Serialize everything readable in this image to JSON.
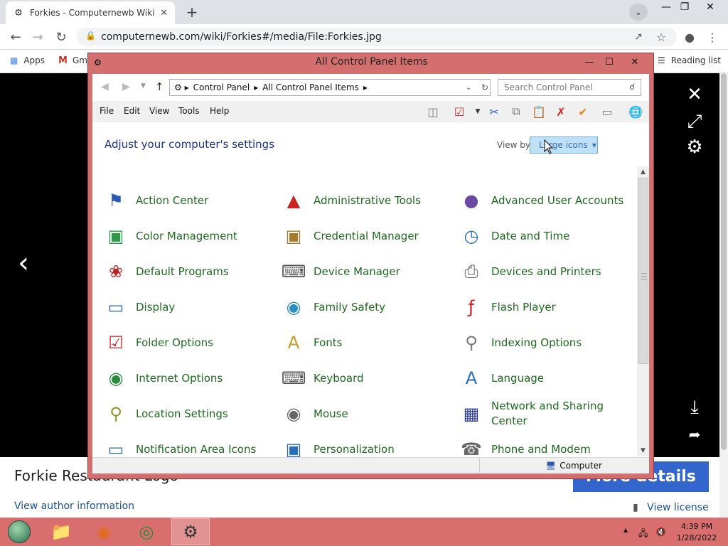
{
  "browser": {
    "tab_title": "Forkies - Computernewb Wiki",
    "url": "computernewb.com/wiki/Forkies#/media/File:Forkies.jpg",
    "bookmarks": [
      "Apps",
      "Gm"
    ],
    "reading_list": "Reading list"
  },
  "viewer": {
    "file_title": "Forkie Restaurant Logo",
    "more_details": "More details",
    "author_link": "View author information",
    "license_link": "View license"
  },
  "control_panel": {
    "title": "All Control Panel Items",
    "breadcrumb": [
      "Control Panel",
      "All Control Panel Items"
    ],
    "search_placeholder": "Search Control Panel",
    "menu": [
      "File",
      "Edit",
      "View",
      "Tools",
      "Help"
    ],
    "heading": "Adjust your computer's settings",
    "view_by_label": "View by:",
    "view_by_value": "Large icons",
    "status_text": "Computer",
    "items": [
      {
        "label": "Action Center",
        "icon": "flag-icon"
      },
      {
        "label": "Administrative Tools",
        "icon": "admin-tools-icon"
      },
      {
        "label": "Advanced User Accounts",
        "icon": "users-icon"
      },
      {
        "label": "Color Management",
        "icon": "color-management-icon"
      },
      {
        "label": "Credential Manager",
        "icon": "credential-icon"
      },
      {
        "label": "Date and Time",
        "icon": "calendar-clock-icon"
      },
      {
        "label": "Default Programs",
        "icon": "default-programs-icon"
      },
      {
        "label": "Device Manager",
        "icon": "device-manager-icon"
      },
      {
        "label": "Devices and Printers",
        "icon": "printer-icon"
      },
      {
        "label": "Display",
        "icon": "monitor-icon"
      },
      {
        "label": "Family Safety",
        "icon": "family-icon"
      },
      {
        "label": "Flash Player",
        "icon": "flash-icon"
      },
      {
        "label": "Folder Options",
        "icon": "folder-options-icon"
      },
      {
        "label": "Fonts",
        "icon": "fonts-icon"
      },
      {
        "label": "Indexing Options",
        "icon": "indexing-icon"
      },
      {
        "label": "Internet Options",
        "icon": "globe-icon"
      },
      {
        "label": "Keyboard",
        "icon": "keyboard-icon"
      },
      {
        "label": "Language",
        "icon": "language-icon"
      },
      {
        "label": "Location Settings",
        "icon": "location-icon"
      },
      {
        "label": "Mouse",
        "icon": "mouse-icon"
      },
      {
        "label": "Network and Sharing Center",
        "icon": "network-icon"
      },
      {
        "label": "Notification Area Icons",
        "icon": "notification-icon"
      },
      {
        "label": "Personalization",
        "icon": "personalization-icon"
      },
      {
        "label": "Phone and Modem",
        "icon": "phone-icon"
      }
    ]
  },
  "taskbar": {
    "time": "4:39 PM",
    "date": "1/28/2022"
  }
}
